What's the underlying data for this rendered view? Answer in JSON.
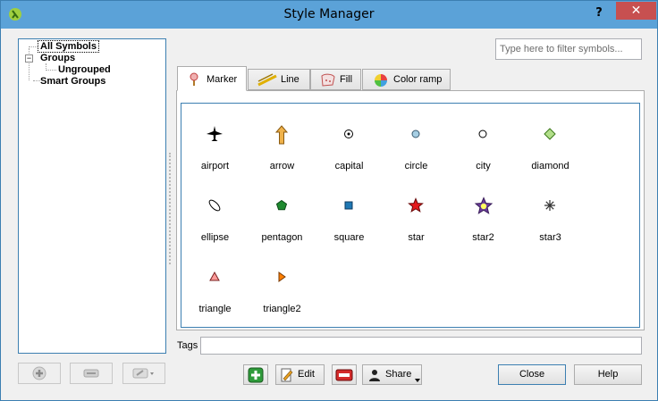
{
  "window": {
    "title": "Style Manager",
    "help_glyph": "?",
    "close_glyph": "✕"
  },
  "tree": {
    "all_symbols": "All Symbols",
    "groups": "Groups",
    "ungrouped": "Ungrouped",
    "smart_groups": "Smart Groups",
    "expander_glyph": "−"
  },
  "filter": {
    "placeholder": "Type here to filter symbols..."
  },
  "tabs": [
    {
      "label": "Marker",
      "icon": "marker-icon",
      "active": true
    },
    {
      "label": "Line",
      "icon": "line-icon",
      "active": false
    },
    {
      "label": "Fill",
      "icon": "fill-icon",
      "active": false
    },
    {
      "label": "Color ramp",
      "icon": "color-ramp-icon",
      "active": false
    }
  ],
  "symbols": [
    {
      "label": "airport",
      "icon": "airport-icon"
    },
    {
      "label": "arrow",
      "icon": "arrow-icon"
    },
    {
      "label": "capital",
      "icon": "capital-icon"
    },
    {
      "label": "circle",
      "icon": "circle-icon"
    },
    {
      "label": "city",
      "icon": "city-icon"
    },
    {
      "label": "diamond",
      "icon": "diamond-icon"
    },
    {
      "label": "ellipse",
      "icon": "ellipse-icon"
    },
    {
      "label": "pentagon",
      "icon": "pentagon-icon"
    },
    {
      "label": "square",
      "icon": "square-icon"
    },
    {
      "label": "star",
      "icon": "star-icon"
    },
    {
      "label": "star2",
      "icon": "star2-icon"
    },
    {
      "label": "star3",
      "icon": "star3-icon"
    },
    {
      "label": "triangle",
      "icon": "triangle-icon"
    },
    {
      "label": "triangle2",
      "icon": "triangle2-icon"
    }
  ],
  "tags": {
    "label": "Tags",
    "value": ""
  },
  "buttons": {
    "edit": "Edit",
    "share": "Share",
    "close": "Close",
    "help": "Help"
  },
  "colors": {
    "titlebar": "#5ba2d8",
    "close_button": "#c75050",
    "focus_border": "#3c7fb1"
  }
}
